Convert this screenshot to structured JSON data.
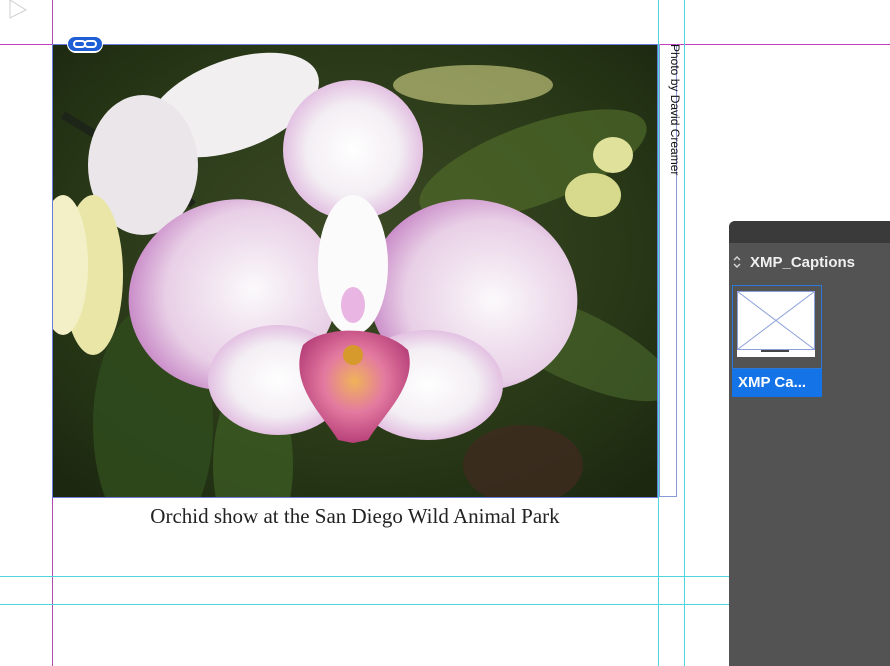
{
  "document": {
    "caption": "Orchid show at the San Diego Wild Animal Park",
    "photo_credit": "Photo by David Creamer",
    "photo_description_icon": "orchid-photo"
  },
  "panel": {
    "title": "XMP_Captions",
    "items": [
      {
        "label": "XMP Ca...",
        "selected": true,
        "icon": "page-thumbnail-icon"
      }
    ]
  },
  "colors": {
    "guide": "#4fd6dc",
    "margin": "#c23fc2",
    "panel_bg": "#535353",
    "selection": "#1473e6"
  }
}
